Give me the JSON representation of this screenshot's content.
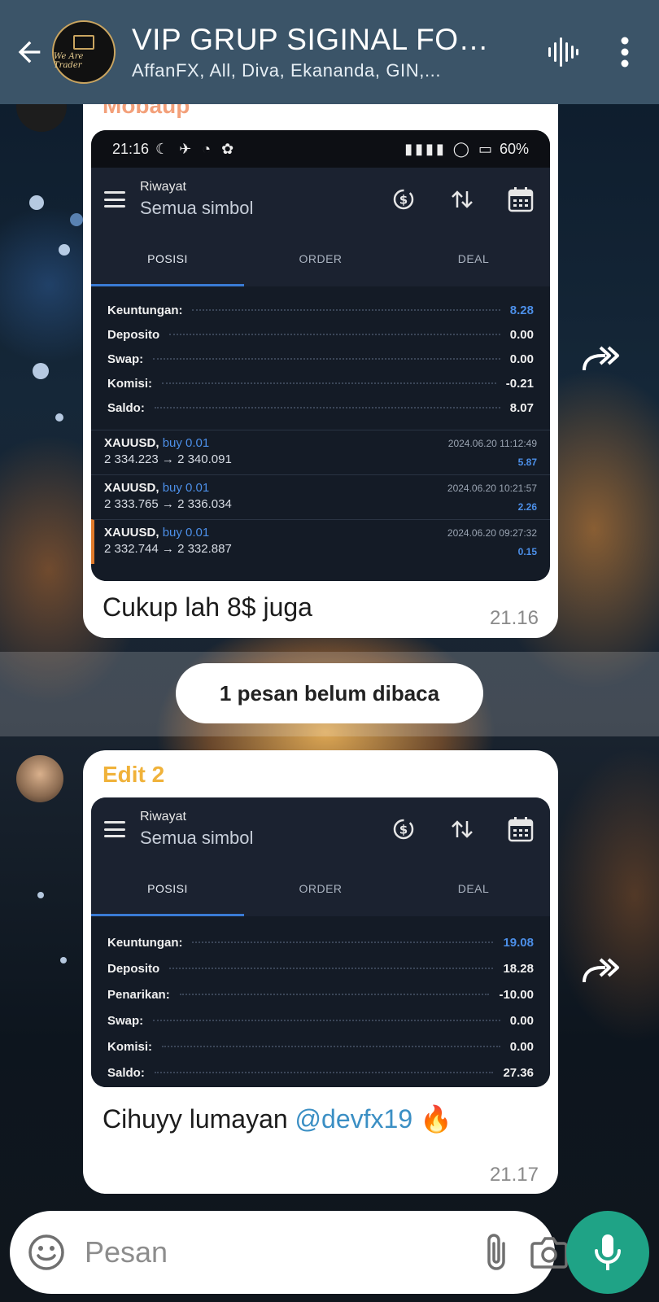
{
  "header": {
    "title": "VIP GRUP SIGINAL FOR...",
    "members": "AffanFX, All, Diva, Ekananda, GIN,...",
    "avatar_text": "We Are Trader",
    "icons": [
      "back-arrow-icon",
      "voice-chat-icon",
      "more-vert-icon"
    ]
  },
  "message1": {
    "sender": "Mobaup",
    "sender_color": "#f3a07a",
    "status_bar": {
      "time": "21:16",
      "battery": "60%"
    },
    "app": {
      "title": "Riwayat",
      "subtitle": "Semua simbol",
      "tabs": [
        "POSISI",
        "ORDER",
        "DEAL"
      ]
    },
    "summary": [
      {
        "label": "Keuntungan:",
        "value": "8.28"
      },
      {
        "label": "Deposito",
        "value": "0.00"
      },
      {
        "label": "Swap:",
        "value": "0.00"
      },
      {
        "label": "Komisi:",
        "value": "-0.21"
      },
      {
        "label": "Saldo:",
        "value": "8.07"
      }
    ],
    "trades": [
      {
        "symbol": "XAUUSD,",
        "side": "buy 0.01",
        "prices": "2 334.223 → 2 340.091",
        "datetime": "2024.06.20 11:12:49",
        "profit": "5.87"
      },
      {
        "symbol": "XAUUSD,",
        "side": "buy 0.01",
        "prices": "2 333.765 → 2 336.034",
        "datetime": "2024.06.20 10:21:57",
        "profit": "2.26"
      },
      {
        "symbol": "XAUUSD,",
        "side": "buy 0.01",
        "prices": "2 332.744 → 2 332.887",
        "datetime": "2024.06.20 09:27:32",
        "profit": "0.15"
      }
    ],
    "text": "Cukup lah 8$ juga",
    "time": "21.16"
  },
  "unread": {
    "label": "1 pesan belum dibaca"
  },
  "message2": {
    "sender": "Edit 2",
    "sender_color": "#f0b23a",
    "app": {
      "title": "Riwayat",
      "subtitle": "Semua simbol",
      "tabs": [
        "POSISI",
        "ORDER",
        "DEAL"
      ]
    },
    "summary": [
      {
        "label": "Keuntungan:",
        "value": "19.08"
      },
      {
        "label": "Deposito",
        "value": "18.28"
      },
      {
        "label": "Penarikan:",
        "value": "-10.00"
      },
      {
        "label": "Swap:",
        "value": "0.00"
      },
      {
        "label": "Komisi:",
        "value": "0.00"
      },
      {
        "label": "Saldo:",
        "value": "27.36"
      }
    ],
    "text": "Cihuyy lumayan",
    "mention": "@devfx19",
    "emoji": "🔥",
    "time": "21.17"
  },
  "input": {
    "placeholder": "Pesan",
    "icons": [
      "emoji-icon",
      "attach-icon",
      "camera-icon",
      "mic-icon"
    ]
  },
  "colors": {
    "header_bg": "#3b5468",
    "accent_green": "#1fa386",
    "profit_blue": "#4c8fe8",
    "mention_blue": "#3b8fc4"
  }
}
